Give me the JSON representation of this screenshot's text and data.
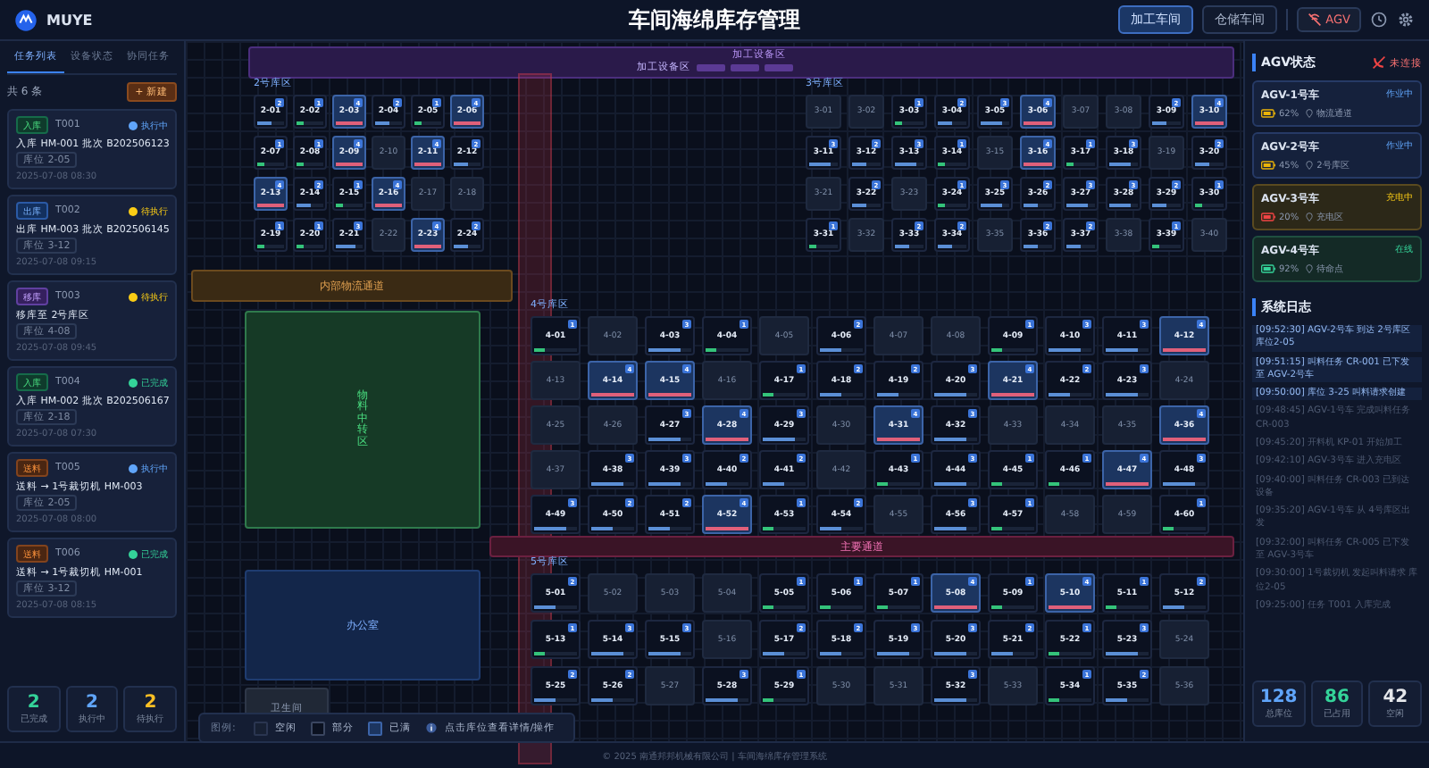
{
  "header": {
    "logo": "MUYE",
    "title": "车间海绵库存管理",
    "workshops": [
      {
        "label": "加工车间",
        "selected": true
      },
      {
        "label": "仓储车间",
        "selected": false
      }
    ],
    "agv_button": {
      "label": "AGV",
      "connected": false
    }
  },
  "left_panel": {
    "tabs": [
      {
        "label": "任务列表",
        "selected": true
      },
      {
        "label": "设备状态",
        "selected": false
      },
      {
        "label": "协同任务",
        "selected": false
      }
    ],
    "count": "共 6 条",
    "new_button": "+ 新建",
    "tasks": [
      {
        "type": "入库",
        "kind": "in",
        "id": "T001",
        "status": "执行中",
        "color": "#60a5fa",
        "text": "入库 HM-001 批次 B202506123",
        "slot": "库位 2-05",
        "time": "2025-07-08 08:30"
      },
      {
        "type": "出库",
        "kind": "out",
        "id": "T002",
        "status": "待执行",
        "color": "#facc15",
        "text": "出库 HM-003 批次 B202506145",
        "slot": "库位 3-12",
        "time": "2025-07-08 09:15"
      },
      {
        "type": "移库",
        "kind": "move",
        "id": "T003",
        "status": "待执行",
        "color": "#facc15",
        "text": "移库至 2号库区",
        "slot": "库位 4-08",
        "time": "2025-07-08 09:45"
      },
      {
        "type": "入库",
        "kind": "in",
        "id": "T004",
        "status": "已完成",
        "color": "#34d399",
        "text": "入库 HM-002 批次 B202506167",
        "slot": "库位 2-18",
        "time": "2025-07-08 07:30"
      },
      {
        "type": "送料",
        "kind": "feed",
        "id": "T005",
        "status": "执行中",
        "color": "#60a5fa",
        "text": "送料 → 1号裁切机 HM-003",
        "slot": "库位 2-05",
        "time": "2025-07-08 08:00"
      },
      {
        "type": "送料",
        "kind": "feed",
        "id": "T006",
        "status": "已完成",
        "color": "#34d399",
        "text": "送料 → 1号裁切机 HM-001",
        "slot": "库位 3-12",
        "time": "2025-07-08 08:15"
      }
    ],
    "stats": [
      {
        "value": "2",
        "label": "已完成",
        "color": "#34d399"
      },
      {
        "value": "2",
        "label": "执行中",
        "color": "#60a5fa"
      },
      {
        "value": "2",
        "label": "待执行",
        "color": "#fbbf24"
      }
    ]
  },
  "map": {
    "processing_area": {
      "title": "加工设备区",
      "subtitle": "加工设备区"
    },
    "zones": [
      {
        "name": "2号库区",
        "rows": [
          [
            {
              "label": "2-01",
              "count": "2",
              "level": 0.5
            },
            {
              "label": "2-02",
              "count": "1",
              "level": 0.25
            },
            {
              "label": "2-03",
              "count": "4",
              "level": 1
            },
            {
              "label": "2-04",
              "count": "2",
              "level": 0.5
            },
            {
              "label": "2-05",
              "count": "1",
              "level": 0.25
            },
            {
              "label": "2-06",
              "count": "4",
              "level": 1
            }
          ],
          [
            {
              "label": "2-07",
              "count": "1",
              "level": 0.25
            },
            {
              "label": "2-08",
              "count": "1",
              "level": 0.25
            },
            {
              "label": "2-09",
              "count": "4",
              "level": 1
            },
            {
              "label": "2-10"
            },
            {
              "label": "2-11",
              "count": "4",
              "level": 1
            },
            {
              "label": "2-12",
              "count": "2",
              "level": 0.5
            }
          ],
          [
            {
              "label": "2-13",
              "count": "4",
              "level": 1
            },
            {
              "label": "2-14",
              "count": "2",
              "level": 0.5
            },
            {
              "label": "2-15",
              "count": "1",
              "level": 0.25
            },
            {
              "label": "2-16",
              "count": "4",
              "level": 1
            },
            {
              "label": "2-17"
            },
            {
              "label": "2-18"
            }
          ],
          [
            {
              "label": "2-19",
              "count": "1",
              "level": 0.25
            },
            {
              "label": "2-20",
              "count": "1",
              "level": 0.25
            },
            {
              "label": "2-21",
              "count": "3",
              "level": 0.75
            },
            {
              "label": "2-22"
            },
            {
              "label": "2-23",
              "count": "4",
              "level": 1
            },
            {
              "label": "2-24",
              "count": "2",
              "level": 0.5
            }
          ]
        ]
      },
      {
        "name": "3号库区",
        "rows": [
          [
            {
              "label": "3-01"
            },
            {
              "label": "3-02"
            },
            {
              "label": "3-03",
              "count": "1",
              "level": 0.25
            },
            {
              "label": "3-04",
              "count": "2",
              "level": 0.5
            },
            {
              "label": "3-05",
              "count": "3",
              "level": 0.75
            },
            {
              "label": "3-06",
              "count": "4",
              "level": 1
            },
            {
              "label": "3-07"
            },
            {
              "label": "3-08"
            },
            {
              "label": "3-09",
              "count": "2",
              "level": 0.5
            },
            {
              "label": "3-10",
              "count": "4",
              "level": 1
            }
          ],
          [
            {
              "label": "3-11",
              "count": "3",
              "level": 0.75
            },
            {
              "label": "3-12",
              "count": "2",
              "level": 0.5
            },
            {
              "label": "3-13",
              "count": "3",
              "level": 0.75
            },
            {
              "label": "3-14",
              "count": "1",
              "level": 0.25
            },
            {
              "label": "3-15"
            },
            {
              "label": "3-16",
              "count": "4",
              "level": 1
            },
            {
              "label": "3-17",
              "count": "1",
              "level": 0.25
            },
            {
              "label": "3-18",
              "count": "3",
              "level": 0.75
            },
            {
              "label": "3-19"
            },
            {
              "label": "3-20",
              "count": "2",
              "level": 0.5
            }
          ],
          [
            {
              "label": "3-21"
            },
            {
              "label": "3-22",
              "count": "2",
              "level": 0.5
            },
            {
              "label": "3-23"
            },
            {
              "label": "3-24",
              "count": "1",
              "level": 0.25
            },
            {
              "label": "3-25",
              "count": "3",
              "level": 0.75
            },
            {
              "label": "3-26",
              "count": "2",
              "level": 0.5
            },
            {
              "label": "3-27",
              "count": "3",
              "level": 0.75
            },
            {
              "label": "3-28",
              "count": "3",
              "level": 0.75
            },
            {
              "label": "3-29",
              "count": "2",
              "level": 0.5
            },
            {
              "label": "3-30",
              "count": "1",
              "level": 0.25
            }
          ],
          [
            {
              "label": "3-31",
              "count": "1",
              "level": 0.25
            },
            {
              "label": "3-32"
            },
            {
              "label": "3-33",
              "count": "2",
              "level": 0.5
            },
            {
              "label": "3-34",
              "count": "2",
              "level": 0.5
            },
            {
              "label": "3-35"
            },
            {
              "label": "3-36",
              "count": "2",
              "level": 0.5
            },
            {
              "label": "3-37",
              "count": "2",
              "level": 0.5
            },
            {
              "label": "3-38"
            },
            {
              "label": "3-39",
              "count": "1",
              "level": 0.25
            },
            {
              "label": "3-40"
            }
          ]
        ]
      },
      {
        "name": "4号库区",
        "rows": [
          [
            {
              "label": "4-01",
              "count": "1",
              "level": 0.25
            },
            {
              "label": "4-02"
            },
            {
              "label": "4-03",
              "count": "3",
              "level": 0.75
            },
            {
              "label": "4-04",
              "count": "1",
              "level": 0.25
            },
            {
              "label": "4-05"
            },
            {
              "label": "4-06",
              "count": "2",
              "level": 0.5
            },
            {
              "label": "4-07"
            },
            {
              "label": "4-08"
            },
            {
              "label": "4-09",
              "count": "1",
              "level": 0.25
            },
            {
              "label": "4-10",
              "count": "3",
              "level": 0.75
            },
            {
              "label": "4-11",
              "count": "3",
              "level": 0.75
            },
            {
              "label": "4-12",
              "count": "4",
              "level": 1
            }
          ],
          [
            {
              "label": "4-13"
            },
            {
              "label": "4-14",
              "count": "4",
              "level": 1
            },
            {
              "label": "4-15",
              "count": "4",
              "level": 1
            },
            {
              "label": "4-16"
            },
            {
              "label": "4-17",
              "count": "1",
              "level": 0.25
            },
            {
              "label": "4-18",
              "count": "2",
              "level": 0.5
            },
            {
              "label": "4-19",
              "count": "2",
              "level": 0.5
            },
            {
              "label": "4-20",
              "count": "3",
              "level": 0.75
            },
            {
              "label": "4-21",
              "count": "4",
              "level": 1
            },
            {
              "label": "4-22",
              "count": "2",
              "level": 0.5
            },
            {
              "label": "4-23",
              "count": "3",
              "level": 0.75
            },
            {
              "label": "4-24"
            }
          ],
          [
            {
              "label": "4-25"
            },
            {
              "label": "4-26"
            },
            {
              "label": "4-27",
              "count": "3",
              "level": 0.75
            },
            {
              "label": "4-28",
              "count": "4",
              "level": 1
            },
            {
              "label": "4-29",
              "count": "3",
              "level": 0.75
            },
            {
              "label": "4-30"
            },
            {
              "label": "4-31",
              "count": "4",
              "level": 1
            },
            {
              "label": "4-32",
              "count": "3",
              "level": 0.75
            },
            {
              "label": "4-33"
            },
            {
              "label": "4-34"
            },
            {
              "label": "4-35"
            },
            {
              "label": "4-36",
              "count": "4",
              "level": 1
            }
          ],
          [
            {
              "label": "4-37"
            },
            {
              "label": "4-38",
              "count": "3",
              "level": 0.75
            },
            {
              "label": "4-39",
              "count": "3",
              "level": 0.75
            },
            {
              "label": "4-40",
              "count": "2",
              "level": 0.5
            },
            {
              "label": "4-41",
              "count": "2",
              "level": 0.5
            },
            {
              "label": "4-42"
            },
            {
              "label": "4-43",
              "count": "1",
              "level": 0.25
            },
            {
              "label": "4-44",
              "count": "3",
              "level": 0.75
            },
            {
              "label": "4-45",
              "count": "1",
              "level": 0.25
            },
            {
              "label": "4-46",
              "count": "1",
              "level": 0.25
            },
            {
              "label": "4-47",
              "count": "4",
              "level": 1
            },
            {
              "label": "4-48",
              "count": "3",
              "level": 0.75
            }
          ],
          [
            {
              "label": "4-49",
              "count": "3",
              "level": 0.75
            },
            {
              "label": "4-50",
              "count": "2",
              "level": 0.5
            },
            {
              "label": "4-51",
              "count": "2",
              "level": 0.5
            },
            {
              "label": "4-52",
              "count": "4",
              "level": 1
            },
            {
              "label": "4-53",
              "count": "1",
              "level": 0.25
            },
            {
              "label": "4-54",
              "count": "2",
              "level": 0.5
            },
            {
              "label": "4-55"
            },
            {
              "label": "4-56",
              "count": "3",
              "level": 0.75
            },
            {
              "label": "4-57",
              "count": "1",
              "level": 0.25
            },
            {
              "label": "4-58"
            },
            {
              "label": "4-59"
            },
            {
              "label": "4-60",
              "count": "1",
              "level": 0.25
            }
          ]
        ]
      },
      {
        "name": "5号库区",
        "rows": [
          [
            {
              "label": "5-01",
              "count": "2",
              "level": 0.5
            },
            {
              "label": "5-02"
            },
            {
              "label": "5-03"
            },
            {
              "label": "5-04"
            },
            {
              "label": "5-05",
              "count": "1",
              "level": 0.25
            },
            {
              "label": "5-06",
              "count": "1",
              "level": 0.25
            },
            {
              "label": "5-07",
              "count": "1",
              "level": 0.25
            },
            {
              "label": "5-08",
              "count": "4",
              "level": 1
            },
            {
              "label": "5-09",
              "count": "1",
              "level": 0.25
            },
            {
              "label": "5-10",
              "count": "4",
              "level": 1
            },
            {
              "label": "5-11",
              "count": "1",
              "level": 0.25
            },
            {
              "label": "5-12",
              "count": "2",
              "level": 0.5
            }
          ],
          [
            {
              "label": "5-13",
              "count": "1",
              "level": 0.25
            },
            {
              "label": "5-14",
              "count": "3",
              "level": 0.75
            },
            {
              "label": "5-15",
              "count": "3",
              "level": 0.75
            },
            {
              "label": "5-16"
            },
            {
              "label": "5-17",
              "count": "2",
              "level": 0.5
            },
            {
              "label": "5-18",
              "count": "2",
              "level": 0.5
            },
            {
              "label": "5-19",
              "count": "3",
              "level": 0.75
            },
            {
              "label": "5-20",
              "count": "3",
              "level": 0.75
            },
            {
              "label": "5-21",
              "count": "2",
              "level": 0.5
            },
            {
              "label": "5-22",
              "count": "1",
              "level": 0.25
            },
            {
              "label": "5-23",
              "count": "3",
              "level": 0.75
            },
            {
              "label": "5-24"
            }
          ],
          [
            {
              "label": "5-25",
              "count": "2",
              "level": 0.5
            },
            {
              "label": "5-26",
              "count": "2",
              "level": 0.5
            },
            {
              "label": "5-27"
            },
            {
              "label": "5-28",
              "count": "3",
              "level": 0.75
            },
            {
              "label": "5-29",
              "count": "1",
              "level": 0.25
            },
            {
              "label": "5-30"
            },
            {
              "label": "5-31"
            },
            {
              "label": "5-32",
              "count": "3",
              "level": 0.75
            },
            {
              "label": "5-33"
            },
            {
              "label": "5-34",
              "count": "1",
              "level": 0.25
            },
            {
              "label": "5-35",
              "count": "2",
              "level": 0.5
            },
            {
              "label": "5-36"
            }
          ]
        ]
      }
    ],
    "areas": [
      {
        "kind": "logistics",
        "label": "内部物流通道"
      },
      {
        "kind": "transfer",
        "label": "物料中转区"
      },
      {
        "kind": "channel",
        "label": "主要通道"
      },
      {
        "kind": "office",
        "label": "办公室"
      },
      {
        "kind": "restroom",
        "label": "卫生间"
      }
    ],
    "legend": {
      "title": "图例:",
      "items": [
        {
          "kind": "empty",
          "label": "空闲"
        },
        {
          "kind": "partial",
          "label": "部分"
        },
        {
          "kind": "full",
          "label": "已满"
        }
      ],
      "hint": "点击库位查看详情/操作"
    }
  },
  "right_panel": {
    "agv_title": "AGV状态",
    "connection": "未连接",
    "agvs": [
      {
        "name": "AGV-1号车",
        "status": "作业中",
        "kind": "working",
        "battery": "62%",
        "color": "#eab308",
        "location": "物流通道"
      },
      {
        "name": "AGV-2号车",
        "status": "作业中",
        "kind": "working",
        "battery": "45%",
        "color": "#eab308",
        "location": "2号库区"
      },
      {
        "name": "AGV-3号车",
        "status": "充电中",
        "kind": "charging",
        "battery": "20%",
        "color": "#ef4444",
        "location": "充电区"
      },
      {
        "name": "AGV-4号车",
        "status": "在线",
        "kind": "idle",
        "battery": "92%",
        "color": "#34d399",
        "location": "待命点"
      }
    ],
    "log_title": "系统日志",
    "logs": [
      {
        "time": "[09:52:30]",
        "text": "AGV-2号车 到达 2号库区库位2-05",
        "recent": true
      },
      {
        "time": "[09:51:15]",
        "text": "叫料任务 CR-001 已下发至 AGV-2号车",
        "recent": true
      },
      {
        "time": "[09:50:00]",
        "text": "库位 3-25 叫料请求创建",
        "recent": true
      },
      {
        "time": "[09:48:45]",
        "text": "AGV-1号车 完成叫料任务 CR-003",
        "recent": false
      },
      {
        "time": "[09:45:20]",
        "text": "开料机 KP-01 开始加工",
        "recent": false
      },
      {
        "time": "[09:42:10]",
        "text": "AGV-3号车 进入充电区",
        "recent": false
      },
      {
        "time": "[09:40:00]",
        "text": "叫料任务 CR-003 已到达设备",
        "recent": false
      },
      {
        "time": "[09:35:20]",
        "text": "AGV-1号车 从 4号库区出发",
        "recent": false
      },
      {
        "time": "[09:32:00]",
        "text": "叫料任务 CR-005 已下发至 AGV-3号车",
        "recent": false
      },
      {
        "time": "[09:30:00]",
        "text": "1号裁切机 发起叫料请求 库位2-05",
        "recent": false
      },
      {
        "time": "[09:25:00]",
        "text": "任务 T001 入库完成",
        "recent": false
      }
    ],
    "stats": [
      {
        "value": "128",
        "label": "总库位",
        "color": "#60a5fa"
      },
      {
        "value": "86",
        "label": "已占用",
        "color": "#34d399"
      },
      {
        "value": "42",
        "label": "空闲",
        "color": "#e5e7eb"
      }
    ]
  },
  "footer": "© 2025 南通邦邦机械有限公司 | 车间海绵库存管理系统"
}
